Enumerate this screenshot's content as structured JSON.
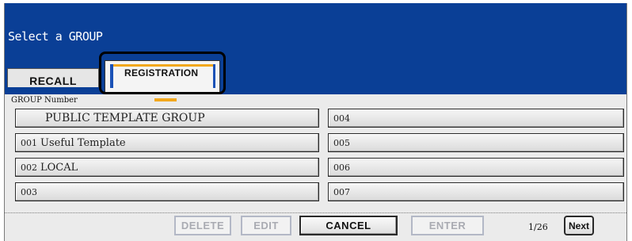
{
  "header": {
    "title": "Select a GROUP"
  },
  "tabs": {
    "recall": "RECALL",
    "registration": "REGISTRATION"
  },
  "section": {
    "label": "GROUP Number"
  },
  "groups_left": [
    {
      "number": "",
      "name": "PUBLIC TEMPLATE GROUP"
    },
    {
      "number": "001",
      "name": "Useful Template"
    },
    {
      "number": "002",
      "name": "LOCAL"
    },
    {
      "number": "003",
      "name": ""
    }
  ],
  "groups_right": [
    {
      "number": "004",
      "name": ""
    },
    {
      "number": "005",
      "name": ""
    },
    {
      "number": "006",
      "name": ""
    },
    {
      "number": "007",
      "name": ""
    }
  ],
  "actions": {
    "delete": "DELETE",
    "edit": "EDIT",
    "cancel": "CANCEL",
    "enter": "ENTER"
  },
  "pagination": {
    "indicator": "1/26",
    "next": "Next"
  },
  "colors": {
    "header_bg": "#0a3f96",
    "accent_orange": "#f2a81d",
    "tab_blue": "#1b52b6"
  }
}
